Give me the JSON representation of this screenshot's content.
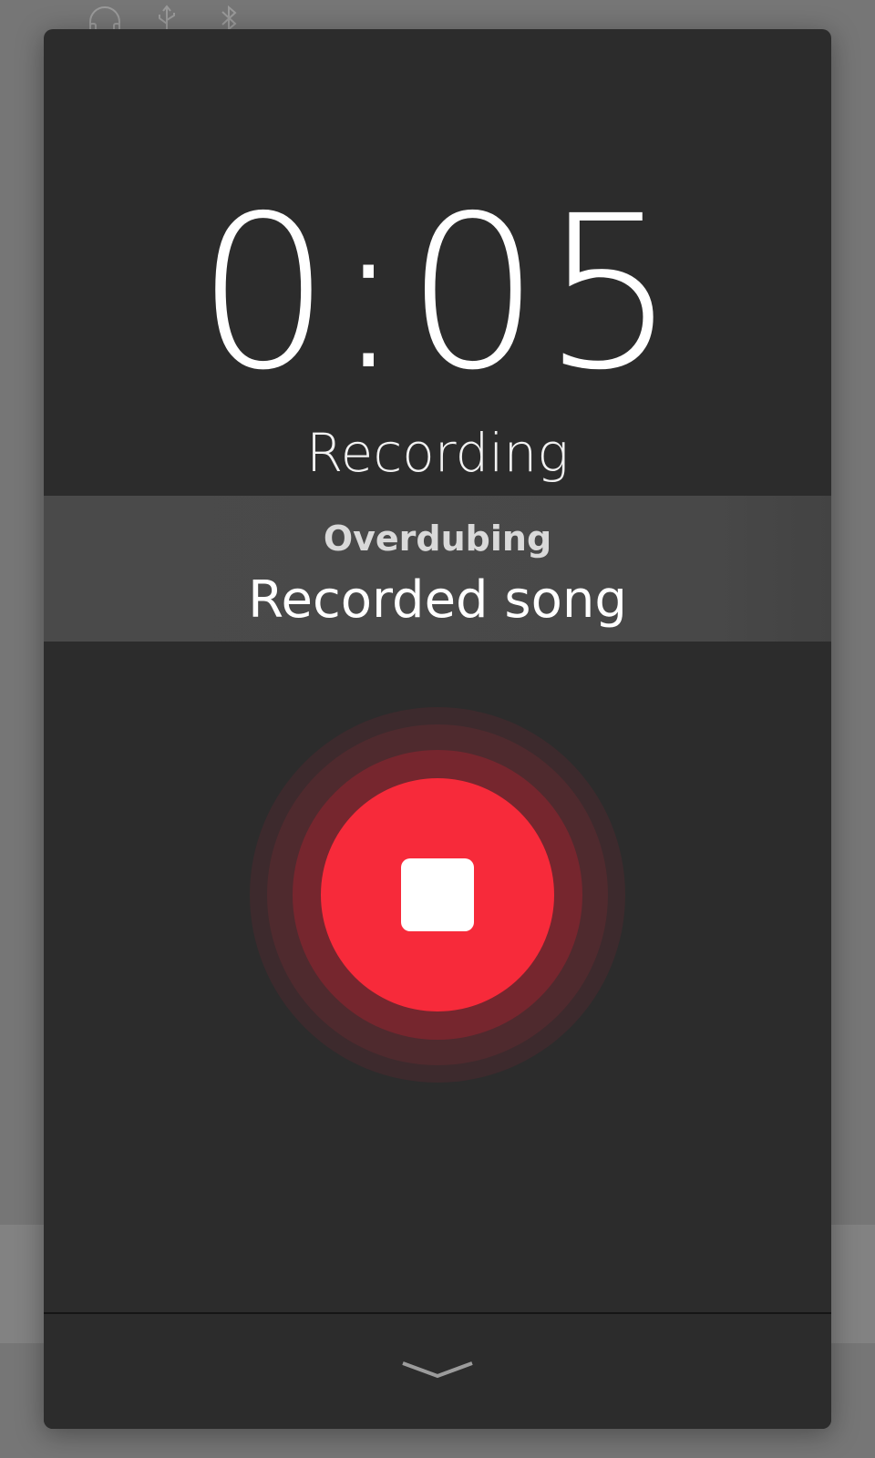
{
  "timer": {
    "elapsed": "0:05"
  },
  "status": {
    "label": "Recording"
  },
  "song": {
    "mode": "Overdubing",
    "name": "Recorded song"
  },
  "controls": {
    "stop_icon": "stop-icon",
    "collapse_icon": "chevron-down-icon"
  },
  "status_bar": {
    "icons": [
      "headphones-icon",
      "usb-icon",
      "bluetooth-icon"
    ]
  },
  "colors": {
    "panel": "#2c2c2c",
    "record_red": "#f72a3a",
    "band": "#4a4a4a"
  }
}
